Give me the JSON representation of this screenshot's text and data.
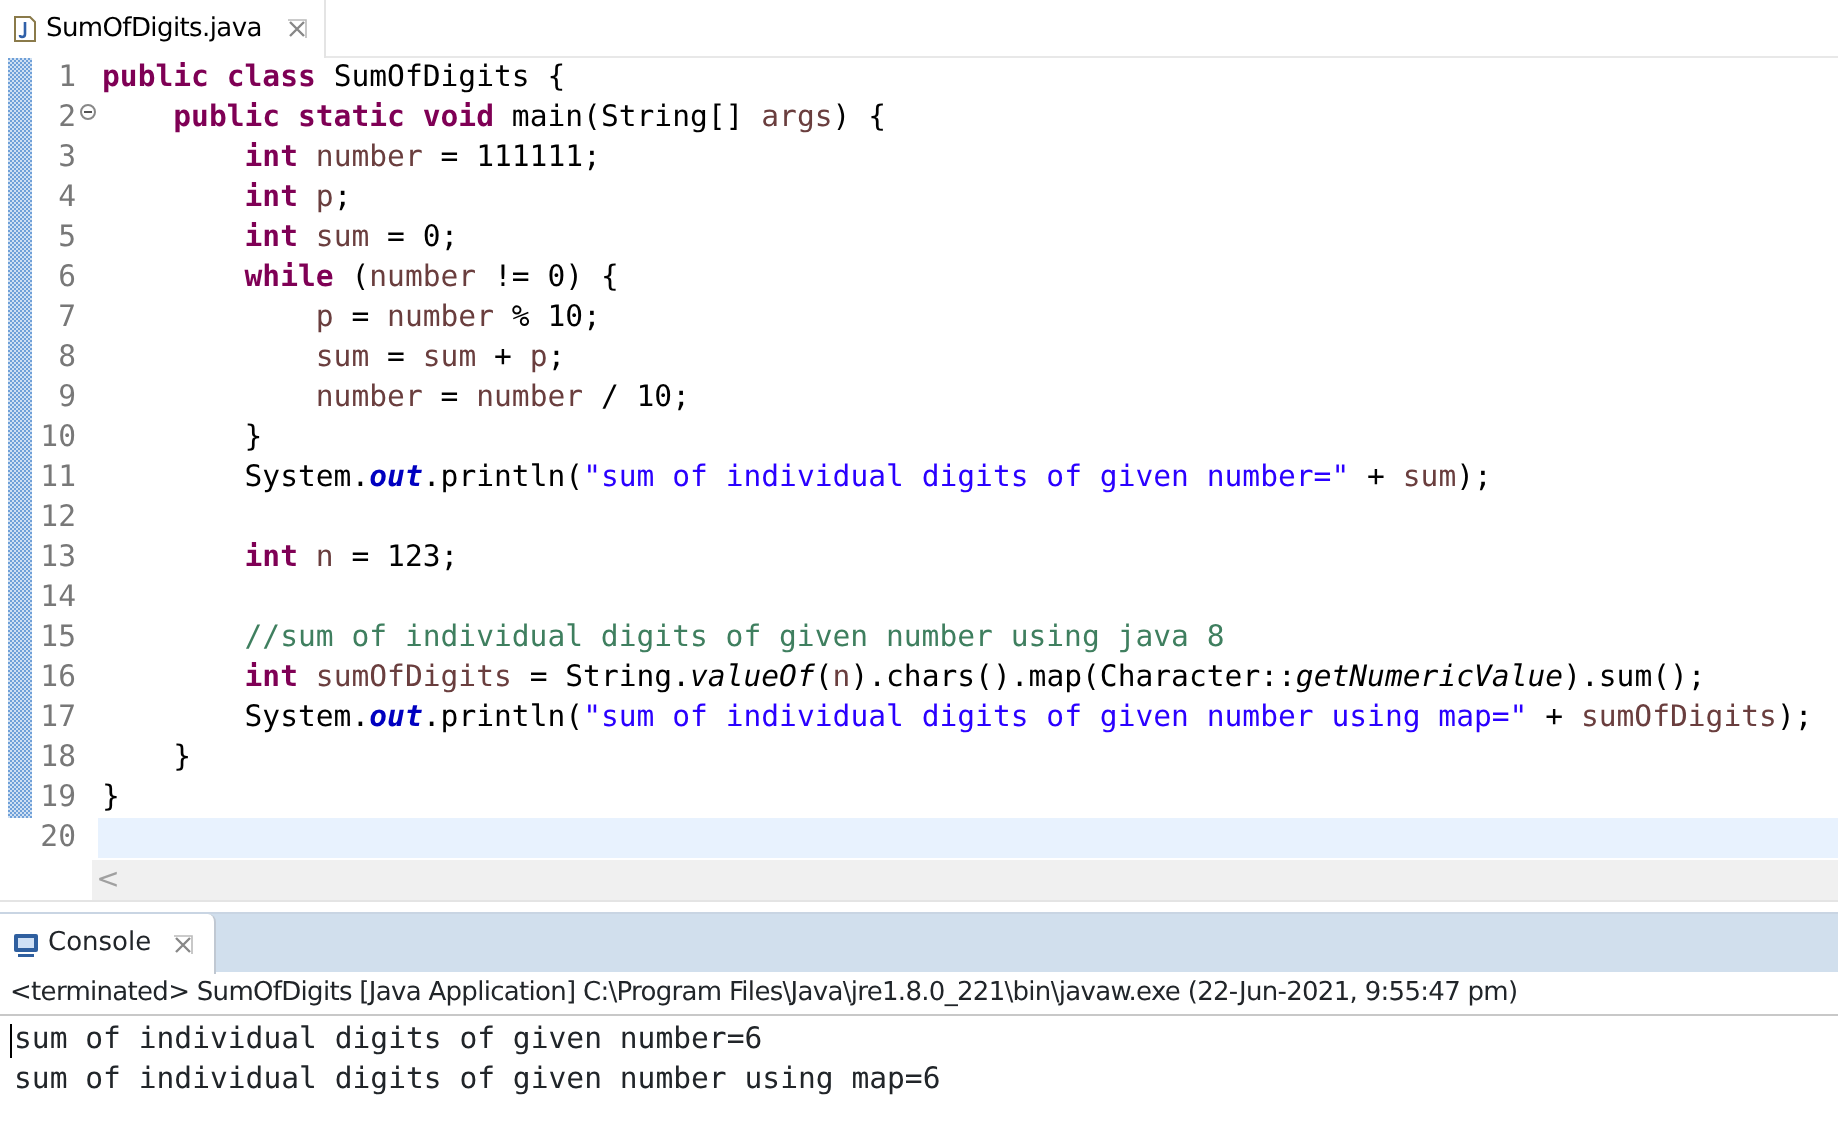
{
  "editor": {
    "tabs": [
      {
        "label": "SumOfDigits.java",
        "selected": true
      }
    ],
    "lines": [
      {
        "number": "1",
        "changed": true,
        "current": false,
        "tokens": [
          {
            "kind": "keyword",
            "text": "public class"
          },
          {
            "kind": "plain",
            "text": " SumOfDigits {"
          }
        ]
      },
      {
        "number": "2",
        "changed": true,
        "current": false,
        "fold_open": true,
        "tokens": [
          {
            "kind": "keyword",
            "text": "    public static void"
          },
          {
            "kind": "plain",
            "text": " main(String[] "
          },
          {
            "kind": "variable",
            "text": "args"
          },
          {
            "kind": "plain",
            "text": ") {"
          }
        ]
      },
      {
        "number": "3",
        "changed": true,
        "current": false,
        "tokens": [
          {
            "kind": "keyword",
            "text": "        int "
          },
          {
            "kind": "variable",
            "text": "number"
          },
          {
            "kind": "plain",
            "text": " = 111111;"
          }
        ]
      },
      {
        "number": "4",
        "changed": true,
        "current": false,
        "tokens": [
          {
            "kind": "keyword",
            "text": "        int "
          },
          {
            "kind": "variable",
            "text": "p"
          },
          {
            "kind": "plain",
            "text": ";"
          }
        ]
      },
      {
        "number": "5",
        "changed": true,
        "current": false,
        "tokens": [
          {
            "kind": "keyword",
            "text": "        int "
          },
          {
            "kind": "variable",
            "text": "sum"
          },
          {
            "kind": "plain",
            "text": " = 0;"
          }
        ]
      },
      {
        "number": "6",
        "changed": true,
        "current": false,
        "tokens": [
          {
            "kind": "keyword",
            "text": "        while"
          },
          {
            "kind": "plain",
            "text": " ("
          },
          {
            "kind": "variable",
            "text": "number"
          },
          {
            "kind": "plain",
            "text": " != 0) {"
          }
        ]
      },
      {
        "number": "7",
        "changed": true,
        "current": false,
        "tokens": [
          {
            "kind": "variable",
            "text": "            p"
          },
          {
            "kind": "plain",
            "text": " = "
          },
          {
            "kind": "variable",
            "text": "number"
          },
          {
            "kind": "plain",
            "text": " % 10;"
          }
        ]
      },
      {
        "number": "8",
        "changed": true,
        "current": false,
        "tokens": [
          {
            "kind": "variable",
            "text": "            sum"
          },
          {
            "kind": "plain",
            "text": " = "
          },
          {
            "kind": "variable",
            "text": "sum"
          },
          {
            "kind": "plain",
            "text": " + "
          },
          {
            "kind": "variable",
            "text": "p"
          },
          {
            "kind": "plain",
            "text": ";"
          }
        ]
      },
      {
        "number": "9",
        "changed": true,
        "current": false,
        "tokens": [
          {
            "kind": "variable",
            "text": "            number"
          },
          {
            "kind": "plain",
            "text": " = "
          },
          {
            "kind": "variable",
            "text": "number"
          },
          {
            "kind": "plain",
            "text": " / 10;"
          }
        ]
      },
      {
        "number": "10",
        "changed": true,
        "current": false,
        "tokens": [
          {
            "kind": "plain",
            "text": "        }"
          }
        ]
      },
      {
        "number": "11",
        "changed": true,
        "current": false,
        "tokens": [
          {
            "kind": "plain",
            "text": "        System."
          },
          {
            "kind": "field",
            "text": "out"
          },
          {
            "kind": "plain",
            "text": ".println("
          },
          {
            "kind": "string",
            "text": "\"sum of individual digits of given number=\""
          },
          {
            "kind": "plain",
            "text": " + "
          },
          {
            "kind": "variable",
            "text": "sum"
          },
          {
            "kind": "plain",
            "text": ");"
          }
        ]
      },
      {
        "number": "12",
        "changed": true,
        "current": false
      },
      {
        "number": "13",
        "changed": true,
        "current": false,
        "tokens": [
          {
            "kind": "keyword",
            "text": "        int "
          },
          {
            "kind": "variable",
            "text": "n"
          },
          {
            "kind": "plain",
            "text": " = 123;"
          }
        ]
      },
      {
        "number": "14",
        "changed": true,
        "current": false
      },
      {
        "number": "15",
        "changed": true,
        "current": false,
        "tokens": [
          {
            "kind": "comment",
            "text": "        //sum of individual digits of given number using java 8"
          }
        ]
      },
      {
        "number": "16",
        "changed": true,
        "current": false,
        "tokens": [
          {
            "kind": "keyword",
            "text": "        int "
          },
          {
            "kind": "variable",
            "text": "sumOfDigits"
          },
          {
            "kind": "plain",
            "text": " = String."
          },
          {
            "kind": "static",
            "text": "valueOf"
          },
          {
            "kind": "plain",
            "text": "("
          },
          {
            "kind": "variable",
            "text": "n"
          },
          {
            "kind": "plain",
            "text": ").chars().map(Character::"
          },
          {
            "kind": "static",
            "text": "getNumericValue"
          },
          {
            "kind": "plain",
            "text": ").sum();"
          }
        ]
      },
      {
        "number": "17",
        "changed": true,
        "current": false,
        "tokens": [
          {
            "kind": "plain",
            "text": "        System."
          },
          {
            "kind": "field",
            "text": "out"
          },
          {
            "kind": "plain",
            "text": ".println("
          },
          {
            "kind": "string",
            "text": "\"sum of individual digits of given number using map=\""
          },
          {
            "kind": "plain",
            "text": " + "
          },
          {
            "kind": "variable",
            "text": "sumOfDigits"
          },
          {
            "kind": "plain",
            "text": ");"
          }
        ]
      },
      {
        "number": "18",
        "changed": true,
        "current": false,
        "tokens": [
          {
            "kind": "plain",
            "text": "    }"
          }
        ]
      },
      {
        "number": "19",
        "changed": true,
        "current": false,
        "tokens": [
          {
            "kind": "plain",
            "text": "}"
          }
        ]
      },
      {
        "number": "20",
        "changed": false,
        "current": true
      }
    ],
    "scroll_left": "<"
  },
  "console": {
    "tabs": [
      {
        "label": "Console",
        "selected": true
      }
    ],
    "description": "<terminated> SumOfDigits [Java Application] C:\\Program Files\\Java\\jre1.8.0_221\\bin\\javaw.exe (22-Jun-2021, 9:55:47 pm)",
    "output": [
      "sum of individual digits of given number=6",
      "sum of individual digits of given number using map=6"
    ]
  }
}
